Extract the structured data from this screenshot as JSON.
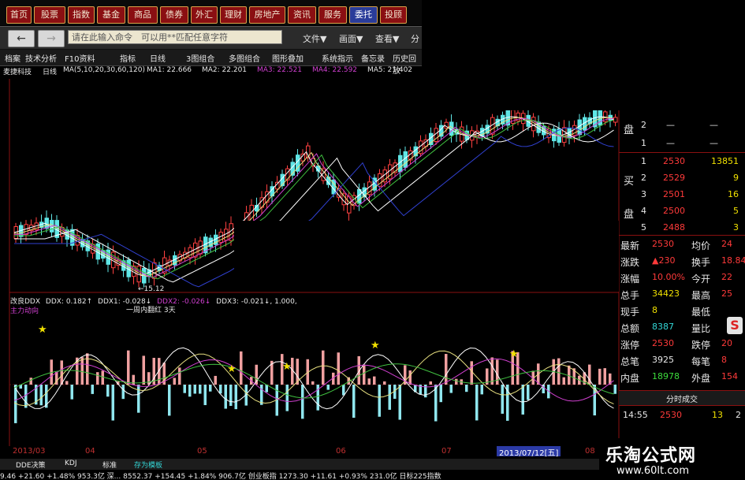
{
  "top_menu": [
    "首页",
    "股票",
    "指数",
    "基金",
    "商品",
    "债券",
    "外汇",
    "理财",
    "房地产",
    "资讯",
    "服务",
    "委托",
    "投顾"
  ],
  "toolbar": {
    "back_label": "←",
    "forward_label": "→",
    "command_placeholder": "请在此输入命令　可以用**匹配任意字符",
    "file_menu": "文件▼",
    "screen_menu": "画面▼",
    "view_menu": "查看▼",
    "split_menu": "分"
  },
  "tabs": [
    "档案",
    "技术分析",
    "F10资料",
    "指标",
    "日线",
    "3图组合",
    "多图组合",
    "图形叠加",
    "系统指示",
    "备忘录",
    "历史回放"
  ],
  "ma_line": {
    "name": "麦捷科技",
    "period": "日线",
    "ma_params": "MA(5,10,20,30,60,120)",
    "ma1": "MA1: 22.666",
    "ma2": "MA2: 22.201",
    "ma3": "MA3: 22.521",
    "ma4": "MA4: 22.592",
    "ma5": "MA5: 21.402"
  },
  "price_low_label": "←15.12",
  "indicator": {
    "header_name": "改良DDX",
    "ddx": "DDX: 0.182↑",
    "ddx1": "DDX1: -0.028↓",
    "ddx2": "DDX2: -0.026↓",
    "ddx3": "DDX3: -0.021↓, 1.000,",
    "sub_label": "主力动向",
    "note": "一周内翻红 3天"
  },
  "order_book": {
    "sell": [
      {
        "level": "2",
        "price": "—",
        "vol": "—"
      },
      {
        "level": "1",
        "price": "—",
        "vol": "—"
      }
    ],
    "sell_label": "盘",
    "buy_label_top": "买",
    "buy_label_bottom": "盘",
    "buy": [
      {
        "level": "1",
        "price": "2530",
        "vol": "13851"
      },
      {
        "level": "2",
        "price": "2529",
        "vol": "9"
      },
      {
        "level": "3",
        "price": "2501",
        "vol": "16"
      },
      {
        "level": "4",
        "price": "2500",
        "vol": "5"
      },
      {
        "level": "5",
        "price": "2488",
        "vol": "3"
      }
    ]
  },
  "quote": [
    {
      "k1": "最新",
      "v1": "2530",
      "k2": "均价",
      "v2": "24"
    },
    {
      "k1": "涨跌",
      "v1": "▲230",
      "k2": "换手",
      "v2": "18.84"
    },
    {
      "k1": "涨幅",
      "v1": "10.00%",
      "k2": "今开",
      "v2": "22"
    },
    {
      "k1": "总手",
      "v1": "34423",
      "k2": "最高",
      "v2": "25"
    },
    {
      "k1": "现手",
      "v1": "8",
      "k2": "最低",
      "v2": ""
    },
    {
      "k1": "总额",
      "v1": "8387",
      "k2": "量比",
      "v2": ""
    },
    {
      "k1": "涨停",
      "v1": "2530",
      "k2": "跌停",
      "v2": "20"
    },
    {
      "k1": "总笔",
      "v1": "3925",
      "k2": "每笔",
      "v2": "8"
    },
    {
      "k1": "内盘",
      "v1": "18978",
      "k2": "外盘",
      "v2": "154"
    }
  ],
  "tick_title": "分时成交",
  "tick": {
    "time": "14:55",
    "price": "2530",
    "vol": "13",
    "extra": "2"
  },
  "dates": {
    "d1": "2013/03",
    "d2": "04",
    "d3": "05",
    "d4": "06",
    "d5": "07",
    "cursor": "2013/07/12[五]",
    "d6": "08"
  },
  "bottom_tabs": [
    "DDE决策",
    "KDJ",
    "标准",
    "存为模板"
  ],
  "bottom_ticker": "9.46  +21.60 +1.48%  953.3亿 深... 8552.37 +154.45 +1.84%  906.7亿 创业板指 1273.30 +11.61 +0.93%  231.0亿 日标225指数",
  "watermark": {
    "title": "乐淘公式网",
    "url": "www.60lt.com"
  },
  "colors": {
    "up": "#ff3a3a",
    "down": "#33d6d6",
    "menu_bg": "#8a0f12",
    "price": "#e8e8e8"
  },
  "chart_data": {
    "type": "candlestick",
    "price_low_label": "15.12",
    "indicator_series": [
      "DDX",
      "DDX1",
      "DDX2",
      "DDX3"
    ]
  }
}
